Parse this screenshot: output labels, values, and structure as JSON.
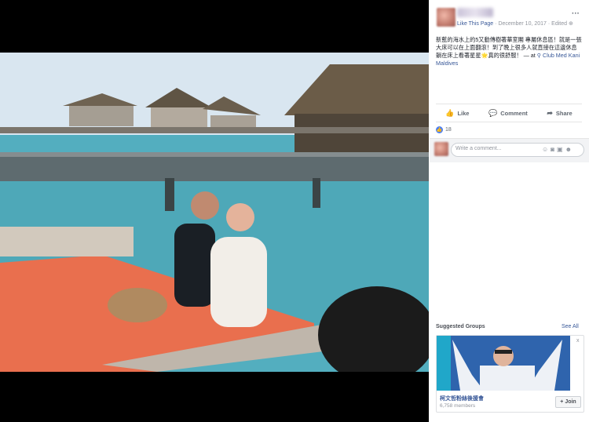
{
  "post": {
    "page_link": "Like This Page",
    "separator": "·",
    "date": "December 10, 2017",
    "edited": "Edited",
    "more": "···",
    "text": "新藍的海水上的5又動傳樹著華室閣 專屬休息區！就是一張大床可以在上面翻滾！到了晚上很多人就直接在這邊休息躺在床上看著星星🌟真的很舒服！ — at",
    "location": "Club Med Kani Maldives"
  },
  "actions": {
    "like": "Like",
    "comment": "Comment",
    "share": "Share"
  },
  "reactions": {
    "count": "18"
  },
  "comment": {
    "placeholder": "Write a comment..."
  },
  "suggested": {
    "title": "Suggested Groups",
    "see_all": "See All",
    "close": "x",
    "group_name": "柯文哲粉絲後援會",
    "members": "6,758 members",
    "join": "+ Join"
  }
}
